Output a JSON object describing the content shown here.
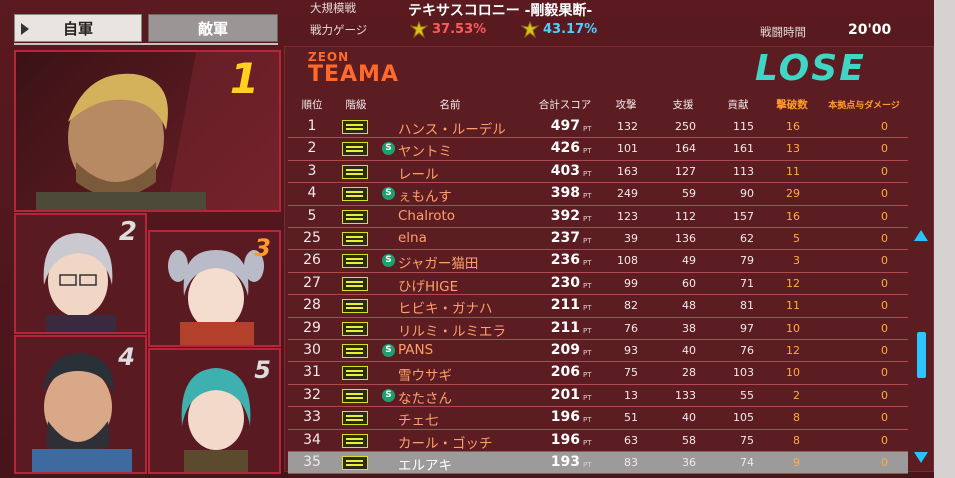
{
  "tabs": {
    "own": "自軍",
    "enemy": "敵軍"
  },
  "header": {
    "mode_label": "大規模戦",
    "map_name": "テキサスコロニー -剛毅果断-",
    "gauge_label": "戦力ゲージ",
    "own_gauge": "37.53%",
    "enemy_gauge": "43.17%",
    "battle_time_label": "戦闘時間",
    "battle_time": "20'00"
  },
  "team": {
    "faction": "ZEON",
    "name": "TEAMA",
    "result": "LOSE"
  },
  "columns": [
    "順位",
    "階級",
    "名前",
    "合計スコア",
    "攻撃",
    "支援",
    "貢献",
    "撃破数",
    "本拠点与ダメージ"
  ],
  "pt_unit": "PT",
  "top_ranks": [
    "1",
    "2",
    "3",
    "4",
    "5"
  ],
  "rows": [
    {
      "rank": "1",
      "s": false,
      "name": "ハンス・ルーデル",
      "score": "497",
      "atk": "132",
      "sup": "250",
      "con": "115",
      "kills": "16",
      "base": "0"
    },
    {
      "rank": "2",
      "s": true,
      "name": "ヤントミ",
      "score": "426",
      "atk": "101",
      "sup": "164",
      "con": "161",
      "kills": "13",
      "base": "0"
    },
    {
      "rank": "3",
      "s": false,
      "name": "レール",
      "score": "403",
      "atk": "163",
      "sup": "127",
      "con": "113",
      "kills": "11",
      "base": "0"
    },
    {
      "rank": "4",
      "s": true,
      "name": "ぇもんす",
      "score": "398",
      "atk": "249",
      "sup": "59",
      "con": "90",
      "kills": "29",
      "base": "0"
    },
    {
      "rank": "5",
      "s": false,
      "name": "Chalroto",
      "score": "392",
      "atk": "123",
      "sup": "112",
      "con": "157",
      "kills": "16",
      "base": "0"
    },
    {
      "rank": "25",
      "s": false,
      "name": "elna",
      "score": "237",
      "atk": "39",
      "sup": "136",
      "con": "62",
      "kills": "5",
      "base": "0"
    },
    {
      "rank": "26",
      "s": true,
      "name": "ジャガー猫田",
      "score": "236",
      "atk": "108",
      "sup": "49",
      "con": "79",
      "kills": "3",
      "base": "0"
    },
    {
      "rank": "27",
      "s": false,
      "name": "ひげHIGE",
      "score": "230",
      "atk": "99",
      "sup": "60",
      "con": "71",
      "kills": "12",
      "base": "0"
    },
    {
      "rank": "28",
      "s": false,
      "name": "ヒビキ・ガナハ",
      "score": "211",
      "atk": "82",
      "sup": "48",
      "con": "81",
      "kills": "11",
      "base": "0"
    },
    {
      "rank": "29",
      "s": false,
      "name": "リルミ・ルミエラ",
      "score": "211",
      "atk": "76",
      "sup": "38",
      "con": "97",
      "kills": "10",
      "base": "0"
    },
    {
      "rank": "30",
      "s": true,
      "name": "PANS",
      "score": "209",
      "atk": "93",
      "sup": "40",
      "con": "76",
      "kills": "12",
      "base": "0"
    },
    {
      "rank": "31",
      "s": false,
      "name": "雪ウサギ",
      "score": "206",
      "atk": "75",
      "sup": "28",
      "con": "103",
      "kills": "10",
      "base": "0"
    },
    {
      "rank": "32",
      "s": true,
      "name": "なたさん",
      "score": "201",
      "atk": "13",
      "sup": "133",
      "con": "55",
      "kills": "2",
      "base": "0"
    },
    {
      "rank": "33",
      "s": false,
      "name": "チェ七",
      "score": "196",
      "atk": "51",
      "sup": "40",
      "con": "105",
      "kills": "8",
      "base": "0"
    },
    {
      "rank": "34",
      "s": false,
      "name": "カール・ゴッチ",
      "score": "196",
      "atk": "63",
      "sup": "58",
      "con": "75",
      "kills": "8",
      "base": "0"
    },
    {
      "rank": "35",
      "s": false,
      "name": "エルアキ",
      "score": "193",
      "atk": "83",
      "sup": "36",
      "con": "74",
      "kills": "9",
      "base": "0",
      "selected": true
    }
  ],
  "colors": {
    "accent_orange": "#ff9a2a",
    "own_gauge": "#ff5a5a",
    "enemy_gauge": "#4fd0ff",
    "lose": "#3fd6c6"
  }
}
